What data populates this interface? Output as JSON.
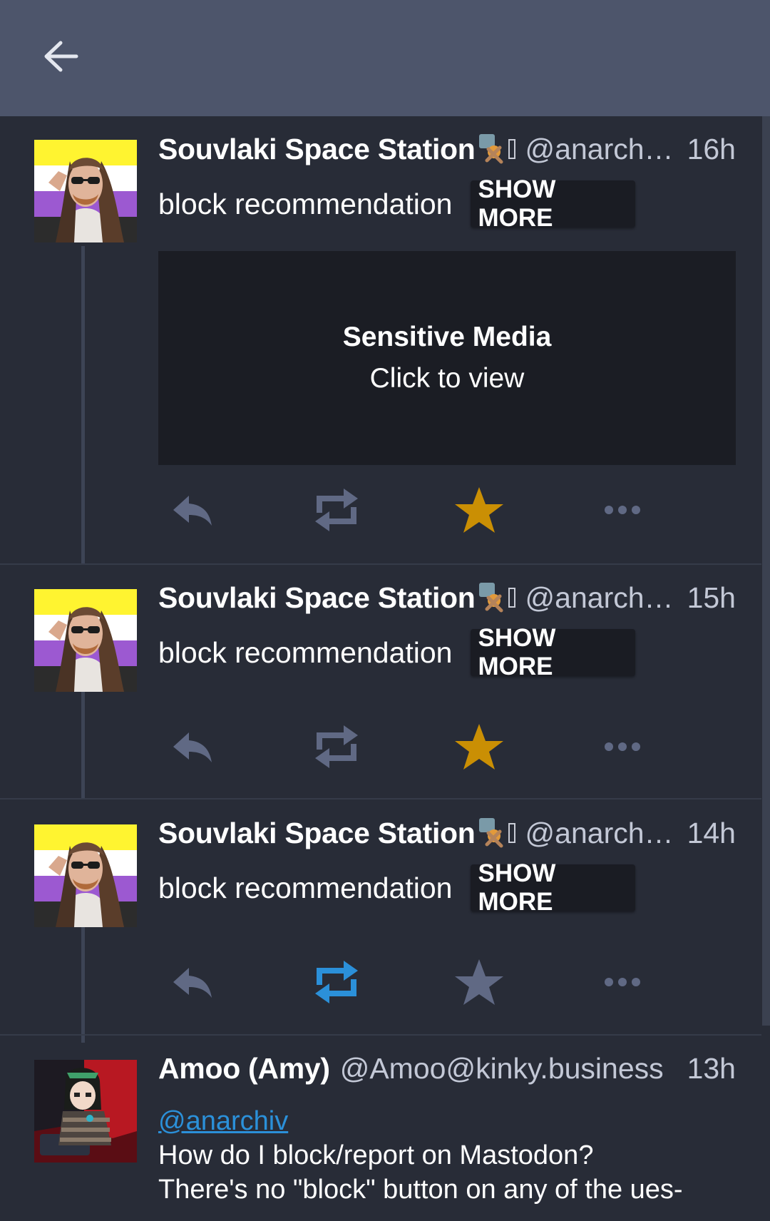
{
  "colors": {
    "appbar": "#4d556b",
    "background": "#282c37",
    "icon_inactive": "#606984",
    "favourited": "#ca8f04",
    "boosted": "#2b90d9",
    "link": "#2b90d9"
  },
  "appbar": {
    "back_icon": "arrow-left-icon"
  },
  "statuses": [
    {
      "display_name": "Souvlaki Space Station",
      "handle": "@anarchi…",
      "time": "16h",
      "spoiler_text": "block recommendation",
      "show_more_label": "SHOW MORE",
      "sensitive_media": {
        "title": "Sensitive Media",
        "subtitle": "Click to view"
      },
      "favourited": true,
      "boosted": false
    },
    {
      "display_name": "Souvlaki Space Station",
      "handle": "@anarchi…",
      "time": "15h",
      "spoiler_text": "block recommendation",
      "show_more_label": "SHOW MORE",
      "favourited": true,
      "boosted": false
    },
    {
      "display_name": "Souvlaki Space Station",
      "handle": "@anarchi…",
      "time": "14h",
      "spoiler_text": "block recommendation",
      "show_more_label": "SHOW MORE",
      "favourited": false,
      "boosted": true
    },
    {
      "display_name": "Amoo (Amy)",
      "handle": "@Amoo@kinky.business",
      "time": "13h",
      "mention": "@anarchiv",
      "content_line1": "How do I block/report on Mastodon?",
      "content_line2": "There's no \"block\" button on any of the ues-"
    }
  ]
}
